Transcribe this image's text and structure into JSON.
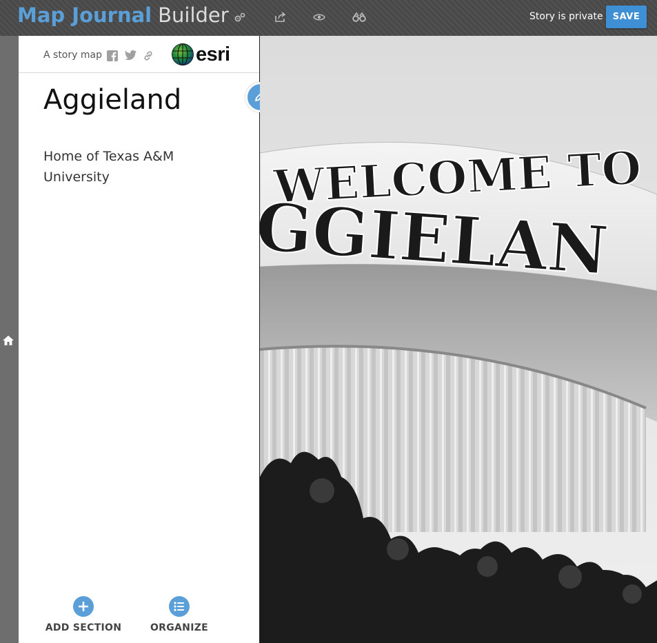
{
  "header": {
    "brand_primary": "Map Journal",
    "brand_secondary": "Builder",
    "icons": [
      "settings-icon",
      "share-icon",
      "preview-icon",
      "binoculars-icon"
    ],
    "status": "Story is private",
    "save_label": "SAVE",
    "accent_color": "#5b9fd8",
    "save_color": "#3e8fd3"
  },
  "panel": {
    "storymap_label": "A story map",
    "share_icons": [
      "facebook-icon",
      "twitter-icon",
      "link-icon"
    ],
    "logo": "esri",
    "title": "Aggieland",
    "subtitle": "Home of Texas A&M University",
    "actions": {
      "add_section": "ADD SECTION",
      "organize": "ORGANIZE"
    }
  },
  "media": {
    "sign_line1": "WELCOME TO",
    "sign_line2": "GGIELAN"
  }
}
